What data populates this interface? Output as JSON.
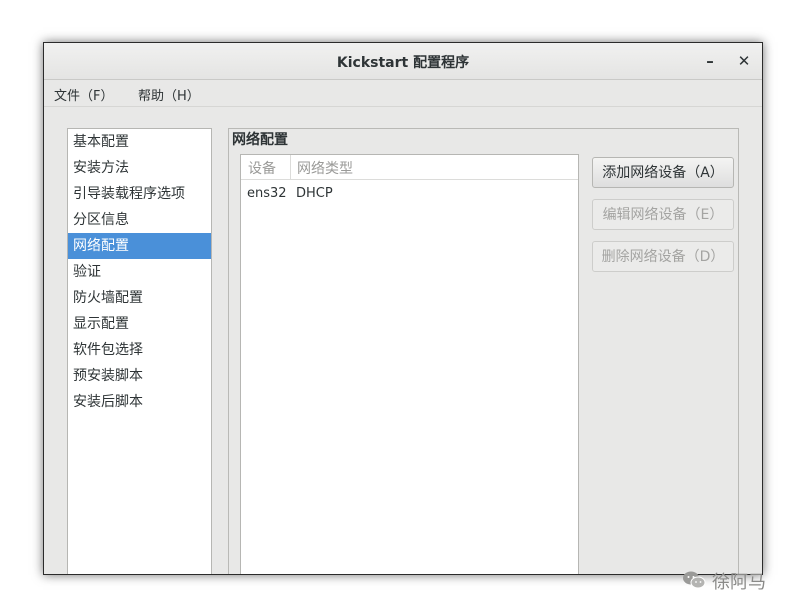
{
  "window": {
    "title": "Kickstart 配置程序",
    "minimize_glyph": "–",
    "close_glyph": "✕"
  },
  "menubar": {
    "items": [
      "文件（F）",
      "帮助（H）"
    ]
  },
  "sidebar": {
    "items": [
      "基本配置",
      "安装方法",
      "引导装载程序选项",
      "分区信息",
      "网络配置",
      "验证",
      "防火墙配置",
      "显示配置",
      "软件包选择",
      "预安装脚本",
      "安装后脚本"
    ],
    "selected_index": 4
  },
  "network_panel": {
    "title": "网络配置",
    "columns": [
      "设备",
      "网络类型"
    ],
    "rows": [
      [
        "ens32",
        "DHCP"
      ]
    ],
    "buttons": {
      "add": "添加网络设备（A）",
      "edit": "编辑网络设备（E）",
      "delete": "删除网络设备（D）"
    }
  },
  "watermark": {
    "icon": "wechat-icon",
    "text": "徐阿马"
  },
  "colors": {
    "selection": "#4a90d9",
    "window_bg": "#e8e8e7"
  }
}
